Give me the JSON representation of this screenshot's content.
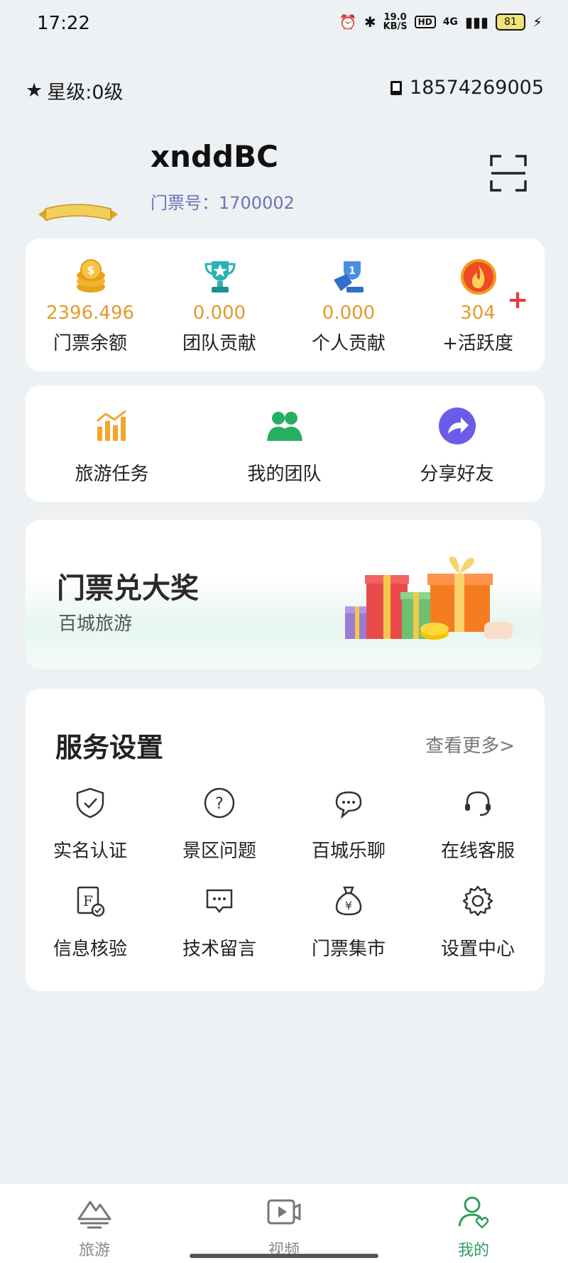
{
  "status_bar": {
    "time": "17:22",
    "speed_value": "19.0",
    "speed_unit": "KB/S",
    "hd": "HD",
    "network": "4G",
    "battery": "81"
  },
  "header": {
    "star_level": "星级:0级",
    "phone": "18574269005",
    "username": "xnddBC",
    "ticket_no_label": "门票号：",
    "ticket_no_value": "1700002"
  },
  "stats": [
    {
      "value": "2396.496",
      "label": "门票余额",
      "icon": "coins-icon"
    },
    {
      "value": "0.000",
      "label": "团队贡献",
      "icon": "team-trophy-icon"
    },
    {
      "value": "0.000",
      "label": "个人贡献",
      "icon": "personal-trophy-icon"
    },
    {
      "value": "304",
      "label": "+活跃度",
      "icon": "flame-icon"
    }
  ],
  "stats_plus": "+",
  "shortcuts": [
    {
      "label": "旅游任务",
      "icon": "bar-chart-icon"
    },
    {
      "label": "我的团队",
      "icon": "team-icon"
    },
    {
      "label": "分享好友",
      "icon": "share-icon"
    }
  ],
  "banner": {
    "title": "门票兑大奖",
    "subtitle": "百城旅游"
  },
  "services": {
    "title": "服务设置",
    "more": "查看更多>",
    "items": [
      {
        "label": "实名认证",
        "icon": "shield-check-icon"
      },
      {
        "label": "景区问题",
        "icon": "question-icon"
      },
      {
        "label": "百城乐聊",
        "icon": "chat-icon"
      },
      {
        "label": "在线客服",
        "icon": "headset-icon"
      },
      {
        "label": "信息核验",
        "icon": "verify-doc-icon"
      },
      {
        "label": "技术留言",
        "icon": "message-icon"
      },
      {
        "label": "门票集市",
        "icon": "money-bag-icon"
      },
      {
        "label": "设置中心",
        "icon": "gear-icon"
      }
    ]
  },
  "bottom_nav": [
    {
      "label": "旅游",
      "icon": "mountain-icon",
      "active": false
    },
    {
      "label": "视频",
      "icon": "video-icon",
      "active": false
    },
    {
      "label": "我的",
      "icon": "profile-icon",
      "active": true
    }
  ],
  "colors": {
    "accent_green": "#2e9e5b",
    "stat_value": "#e59a2a",
    "ticket_no": "#6a73b9",
    "plus_red": "#e23b3b",
    "background": "#eef1f4"
  }
}
